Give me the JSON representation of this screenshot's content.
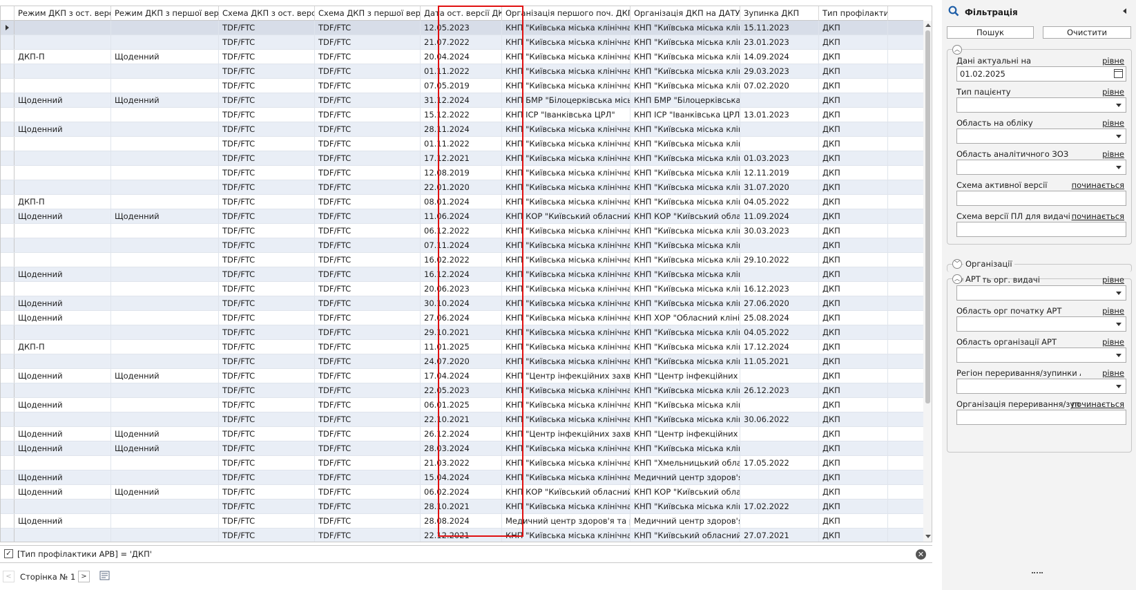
{
  "grid": {
    "columns": [
      {
        "key": "indicator",
        "label": ""
      },
      {
        "key": "mode_last",
        "label": "Режим ДКП з ост. версії"
      },
      {
        "key": "mode_first",
        "label": "Режим ДКП з першої версії"
      },
      {
        "key": "scheme_last",
        "label": "Схема ДКП з ост. версії"
      },
      {
        "key": "scheme_first",
        "label": "Схема ДКП з першої версії"
      },
      {
        "key": "date_last",
        "label": "Дата ост. версії ДКП"
      },
      {
        "key": "org_first",
        "label": "Організація першого поч. ДКП"
      },
      {
        "key": "org_date",
        "label": "Організація ДКП на ДАТУ"
      },
      {
        "key": "stop",
        "label": "Зупинка ДКП"
      },
      {
        "key": "type",
        "label": "Тип профілактики"
      }
    ],
    "rows": [
      [
        "",
        "",
        "TDF/FTC",
        "TDF/FTC",
        "12.05.2023",
        "КНП \"Київська міська клінічна л...",
        "КНП \"Київська міська клінічна...",
        "15.11.2023",
        "ДКП"
      ],
      [
        "",
        "",
        "TDF/FTC",
        "TDF/FTC",
        "21.07.2022",
        "КНП \"Київська міська клінічна л...",
        "КНП \"Київська міська клінічна...",
        "23.01.2023",
        "ДКП"
      ],
      [
        "ДКП-П",
        "Щоденний",
        "TDF/FTC",
        "TDF/FTC",
        "20.04.2024",
        "КНП \"Київська міська клінічна л...",
        "КНП \"Київська міська клінічна...",
        "14.09.2024",
        "ДКП"
      ],
      [
        "",
        "",
        "TDF/FTC",
        "TDF/FTC",
        "01.11.2022",
        "КНП \"Київська міська клінічна л...",
        "КНП \"Київська міська клінічна...",
        "29.03.2023",
        "ДКП"
      ],
      [
        "",
        "",
        "TDF/FTC",
        "TDF/FTC",
        "07.05.2019",
        "КНП \"Київська міська клінічна л...",
        "КНП \"Київська міська клінічна...",
        "07.02.2020",
        "ДКП"
      ],
      [
        "Щоденний",
        "Щоденний",
        "TDF/FTC",
        "TDF/FTC",
        "31.12.2024",
        "КНП БМР \"Білоцерківська міськ...",
        "КНП БМР \"Білоцерківська...",
        "",
        "ДКП"
      ],
      [
        "",
        "",
        "TDF/FTC",
        "TDF/FTC",
        "15.12.2022",
        "КНП ІСР \"Іванківська ЦРЛ\"",
        "КНП ІСР \"Іванківська ЦРЛ\"",
        "13.01.2023",
        "ДКП"
      ],
      [
        "Щоденний",
        "",
        "TDF/FTC",
        "TDF/FTC",
        "28.11.2024",
        "КНП \"Київська міська клінічна л...",
        "КНП \"Київська міська клінічна...",
        "",
        "ДКП"
      ],
      [
        "",
        "",
        "TDF/FTC",
        "TDF/FTC",
        "01.11.2022",
        "КНП \"Київська міська клінічна л...",
        "КНП \"Київська міська клінічна...",
        "",
        "ДКП"
      ],
      [
        "",
        "",
        "TDF/FTC",
        "TDF/FTC",
        "17.12.2021",
        "КНП \"Київська міська клінічна л...",
        "КНП \"Київська міська клінічна...",
        "01.03.2023",
        "ДКП"
      ],
      [
        "",
        "",
        "TDF/FTC",
        "TDF/FTC",
        "12.08.2019",
        "КНП \"Київська міська клінічна л...",
        "КНП \"Київська міська клінічна...",
        "12.11.2019",
        "ДКП"
      ],
      [
        "",
        "",
        "TDF/FTC",
        "TDF/FTC",
        "22.01.2020",
        "КНП \"Київська міська клінічна л...",
        "КНП \"Київська міська клінічна...",
        "31.07.2020",
        "ДКП"
      ],
      [
        "ДКП-П",
        "",
        "TDF/FTC",
        "TDF/FTC",
        "08.01.2024",
        "КНП \"Київська міська клінічна л...",
        "КНП \"Київська міська клінічна...",
        "04.05.2022",
        "ДКП"
      ],
      [
        "Щоденний",
        "Щоденний",
        "TDF/FTC",
        "TDF/FTC",
        "11.06.2024",
        "КНП КОР \"Київський обласний...",
        "КНП КОР \"Київський облас...",
        "11.09.2024",
        "ДКП"
      ],
      [
        "",
        "",
        "TDF/FTC",
        "TDF/FTC",
        "06.12.2022",
        "КНП \"Київська міська клінічна л...",
        "КНП \"Київська міська клінічна...",
        "30.03.2023",
        "ДКП"
      ],
      [
        "",
        "",
        "TDF/FTC",
        "TDF/FTC",
        "07.11.2024",
        "КНП \"Київська міська клінічна л...",
        "КНП \"Київська міська клінічна...",
        "",
        "ДКП"
      ],
      [
        "",
        "",
        "TDF/FTC",
        "TDF/FTC",
        "16.02.2022",
        "КНП \"Київська міська клінічна л...",
        "КНП \"Київська міська клінічна...",
        "29.10.2022",
        "ДКП"
      ],
      [
        "Щоденний",
        "",
        "TDF/FTC",
        "TDF/FTC",
        "16.12.2024",
        "КНП \"Київська міська клінічна л...",
        "КНП \"Київська міська клінічна...",
        "",
        "ДКП"
      ],
      [
        "",
        "",
        "TDF/FTC",
        "TDF/FTC",
        "20.06.2023",
        "КНП \"Київська міська клінічна л...",
        "КНП \"Київська міська клінічна...",
        "16.12.2023",
        "ДКП"
      ],
      [
        "Щоденний",
        "",
        "TDF/FTC",
        "TDF/FTC",
        "30.10.2024",
        "КНП \"Київська міська клінічна л...",
        "КНП \"Київська міська клінічна...",
        "27.06.2020",
        "ДКП"
      ],
      [
        "Щоденний",
        "",
        "TDF/FTC",
        "TDF/FTC",
        "27.06.2024",
        "КНП \"Київська міська клінічна л...",
        "КНП ХОР \"Обласний клініч...",
        "25.08.2024",
        "ДКП"
      ],
      [
        "",
        "",
        "TDF/FTC",
        "TDF/FTC",
        "29.10.2021",
        "КНП \"Київська міська клінічна л...",
        "КНП \"Київська міська клінічна...",
        "04.05.2022",
        "ДКП"
      ],
      [
        "ДКП-П",
        "",
        "TDF/FTC",
        "TDF/FTC",
        "11.01.2025",
        "КНП \"Київська міська клінічна л...",
        "КНП \"Київська міська клінічна...",
        "17.12.2024",
        "ДКП"
      ],
      [
        "",
        "",
        "TDF/FTC",
        "TDF/FTC",
        "24.07.2020",
        "КНП \"Київська міська клінічна л...",
        "КНП \"Київська міська клінічна...",
        "11.05.2021",
        "ДКП"
      ],
      [
        "Щоденний",
        "Щоденний",
        "TDF/FTC",
        "TDF/FTC",
        "17.04.2024",
        "КНП \"Центр інфекційних захвор...",
        "КНП \"Центр інфекційних з...",
        "",
        "ДКП"
      ],
      [
        "",
        "",
        "TDF/FTC",
        "TDF/FTC",
        "22.05.2023",
        "КНП \"Київська міська клінічна л...",
        "КНП \"Київська міська клінічна...",
        "26.12.2023",
        "ДКП"
      ],
      [
        "Щоденний",
        "",
        "TDF/FTC",
        "TDF/FTC",
        "06.01.2025",
        "КНП \"Київська міська клінічна л...",
        "КНП \"Київська міська клінічна...",
        "",
        "ДКП"
      ],
      [
        "",
        "",
        "TDF/FTC",
        "TDF/FTC",
        "22.10.2021",
        "КНП \"Київська міська клінічна л...",
        "КНП \"Київська міська клінічна...",
        "30.06.2022",
        "ДКП"
      ],
      [
        "Щоденний",
        "Щоденний",
        "TDF/FTC",
        "TDF/FTC",
        "26.12.2024",
        "КНП \"Центр інфекційних захвор...",
        "КНП \"Центр інфекційних з...",
        "",
        "ДКП"
      ],
      [
        "Щоденний",
        "Щоденний",
        "TDF/FTC",
        "TDF/FTC",
        "28.03.2024",
        "КНП \"Київська міська клінічна л...",
        "КНП \"Київська міська клінічна...",
        "",
        "ДКП"
      ],
      [
        "",
        "",
        "TDF/FTC",
        "TDF/FTC",
        "21.03.2022",
        "КНП \"Київська міська клінічна л...",
        "КНП \"Хмельницький облас...",
        "17.05.2022",
        "ДКП"
      ],
      [
        "Щоденний",
        "",
        "TDF/FTC",
        "TDF/FTC",
        "15.04.2024",
        "КНП \"Київська міська клінічна л...",
        "Медичний центр здоров'я...",
        "",
        "ДКП"
      ],
      [
        "Щоденний",
        "Щоденний",
        "TDF/FTC",
        "TDF/FTC",
        "06.02.2024",
        "КНП КОР \"Київський обласний...",
        "КНП КОР \"Київський облас...",
        "",
        "ДКП"
      ],
      [
        "",
        "",
        "TDF/FTC",
        "TDF/FTC",
        "28.10.2021",
        "КНП \"Київська міська клінічна л...",
        "КНП \"Київська міська клінічна...",
        "17.02.2022",
        "ДКП"
      ],
      [
        "Щоденний",
        "",
        "TDF/FTC",
        "TDF/FTC",
        "28.08.2024",
        "Медичний центр здоров'я та ре...",
        "Медичний центр здоров'я...",
        "",
        "ДКП"
      ],
      [
        "",
        "",
        "TDF/FTC",
        "TDF/FTC",
        "22.12.2021",
        "КНП \"Київська міська клінічна л...",
        "КНП \"Київський обласний...",
        "27.07.2021",
        "ДКП"
      ]
    ]
  },
  "filter_bar": {
    "checked": true,
    "text": "[Тип профілактики АРВ] = 'ДКП'"
  },
  "pager": {
    "label": "Сторінка № 1"
  },
  "panel": {
    "title": "Фільтрація",
    "search_label": "Пошук",
    "clear_label": "Очистити",
    "fields": [
      {
        "label": "Дані актуальні на",
        "op": "рівне",
        "value": "01.02.2025",
        "kind": "date"
      },
      {
        "label": "Тип пацієнту",
        "op": "рівне",
        "value": "",
        "kind": "select"
      },
      {
        "label": "Область на обліку",
        "op": "рівне",
        "value": "",
        "kind": "select"
      },
      {
        "label": "Область аналітичного ЗОЗ",
        "op": "рівне",
        "value": "",
        "kind": "select"
      },
      {
        "label": "Схема активної версії",
        "op": "починається",
        "value": "",
        "kind": "text"
      },
      {
        "label": "Схема версії ПЛ для видачі",
        "op": "починається",
        "value": "",
        "kind": "text"
      }
    ],
    "organizations_label": "Організації",
    "art_label": "АРТ",
    "art_fields": [
      {
        "label": "Область орг. видачі",
        "op": "рівне",
        "value": "",
        "kind": "select"
      },
      {
        "label": "Область орг початку АРТ",
        "op": "рівне",
        "value": "",
        "kind": "select"
      },
      {
        "label": "Область організації АРТ",
        "op": "рівне",
        "value": "",
        "kind": "select"
      },
      {
        "label": "Регіон переривання/зупинки А",
        "op": "рівне",
        "value": "",
        "kind": "select"
      },
      {
        "label": "Організація переривання/зупи",
        "op": "починається",
        "value": "",
        "kind": "text"
      }
    ]
  },
  "colors": {
    "row_alt": "#e9eef6",
    "row_selected": "#d7dde8",
    "highlight_border": "#e01010",
    "panel_bg": "#f3f3f3",
    "search_icon": "#1f5fa8"
  }
}
